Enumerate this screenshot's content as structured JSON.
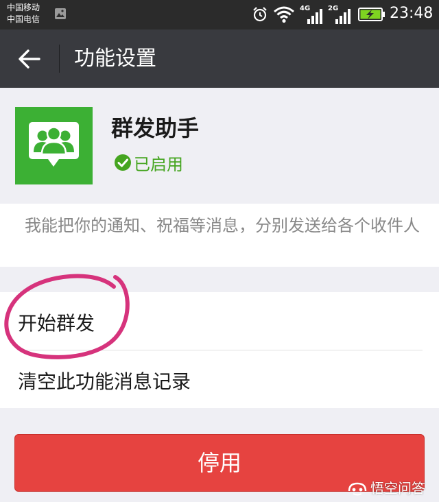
{
  "status_bar": {
    "carrier_1": "中国移动",
    "carrier_2": "中国电信",
    "network_1": "4G",
    "network_2": "2G",
    "time": "23:48",
    "icons": [
      "gallery-icon",
      "alarm-icon",
      "wifi-icon",
      "signal-icon",
      "battery-charging-icon"
    ]
  },
  "title_bar": {
    "back_icon": "arrow-left-icon",
    "title": "功能设置"
  },
  "app": {
    "name": "群发助手",
    "logo_icon": "group-chat-icon",
    "status_icon": "check-circle-icon",
    "status": "已启用",
    "description": "我能把你的通知、祝福等消息，分别发送给各个收件人"
  },
  "menu": {
    "items": [
      {
        "label": "开始群发"
      },
      {
        "label": "清空此功能消息记录"
      }
    ]
  },
  "disable_button": {
    "label": "停用"
  },
  "watermark": {
    "text": "悟空问答"
  },
  "colors": {
    "status_bar_bg": "#2b2b2b",
    "title_bar_bg": "#393a3f",
    "app_logo_bg": "#3cb034",
    "enabled_text": "#45a520",
    "disable_button": "#e64340",
    "annotation": "#d6337c"
  }
}
